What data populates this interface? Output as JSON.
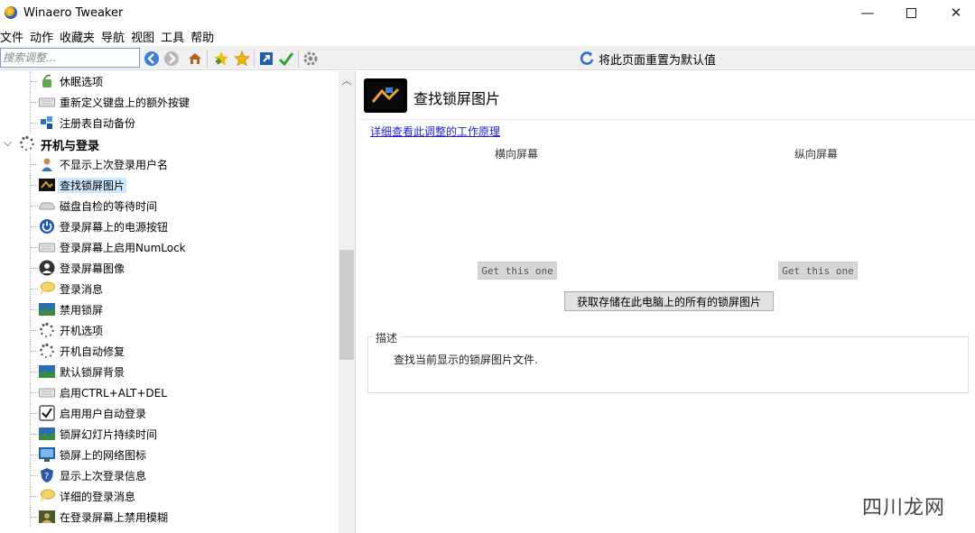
{
  "window": {
    "title": "Winaero Tweaker",
    "minimize": "—",
    "close": "✕"
  },
  "menu": [
    "文件",
    "动作",
    "收藏夹",
    "导航",
    "视图",
    "工具",
    "帮助"
  ],
  "toolbar": {
    "search_placeholder": "搜索调整...",
    "reset_label": "将此页面重置为默认值"
  },
  "tree": {
    "items_before": [
      {
        "label": "休眠选项",
        "icon": "sleep-icon"
      },
      {
        "label": "重新定义键盘上的额外按键",
        "icon": "keyboard-icon"
      },
      {
        "label": "注册表自动备份",
        "icon": "registry-icon"
      }
    ],
    "category": {
      "label": "开机与登录",
      "icon": "spinner-icon",
      "expanded": true
    },
    "items": [
      {
        "label": "不显示上次登录用户名",
        "icon": "user-icon"
      },
      {
        "label": "查找锁屏图片",
        "icon": "lockscreen-image-icon",
        "selected": true
      },
      {
        "label": "磁盘自检的等待时间",
        "icon": "disk-icon"
      },
      {
        "label": "登录屏幕上的电源按钮",
        "icon": "power-icon"
      },
      {
        "label": "登录屏幕上启用NumLock",
        "icon": "keyboard-icon"
      },
      {
        "label": "登录屏幕图像",
        "icon": "avatar-icon"
      },
      {
        "label": "登录消息",
        "icon": "message-icon"
      },
      {
        "label": "禁用锁屏",
        "icon": "landscape-icon"
      },
      {
        "label": "开机选项",
        "icon": "spinner-icon"
      },
      {
        "label": "开机自动修复",
        "icon": "spinner-icon"
      },
      {
        "label": "默认锁屏背景",
        "icon": "landscape-icon"
      },
      {
        "label": "启用CTRL+ALT+DEL",
        "icon": "keyboard-icon"
      },
      {
        "label": "启用用户自动登录",
        "icon": "checkbox-icon"
      },
      {
        "label": "锁屏幻灯片持续时间",
        "icon": "landscape-icon"
      },
      {
        "label": "锁屏上的网络图标",
        "icon": "network-icon"
      },
      {
        "label": "显示上次登录信息",
        "icon": "shield-icon"
      },
      {
        "label": "详细的登录消息",
        "icon": "message-icon"
      },
      {
        "label": "在登录屏幕上禁用模糊",
        "icon": "blur-icon"
      }
    ]
  },
  "content": {
    "title": "查找锁屏图片",
    "learn_link": "详细查看此调整的工作原理",
    "landscape_label": "横向屏幕",
    "portrait_label": "纵向屏幕",
    "get_button": "Get this one",
    "get_all_button": "获取存储在此电脑上的所有的锁屏图片",
    "description_legend": "描述",
    "description_text": "查找当前显示的锁屏图片文件."
  },
  "watermark": "四川龙网",
  "colors": {
    "selected_bg": "#cce8ff",
    "link": "#2222cc",
    "toolbar_bg": "#f0f0f0"
  }
}
